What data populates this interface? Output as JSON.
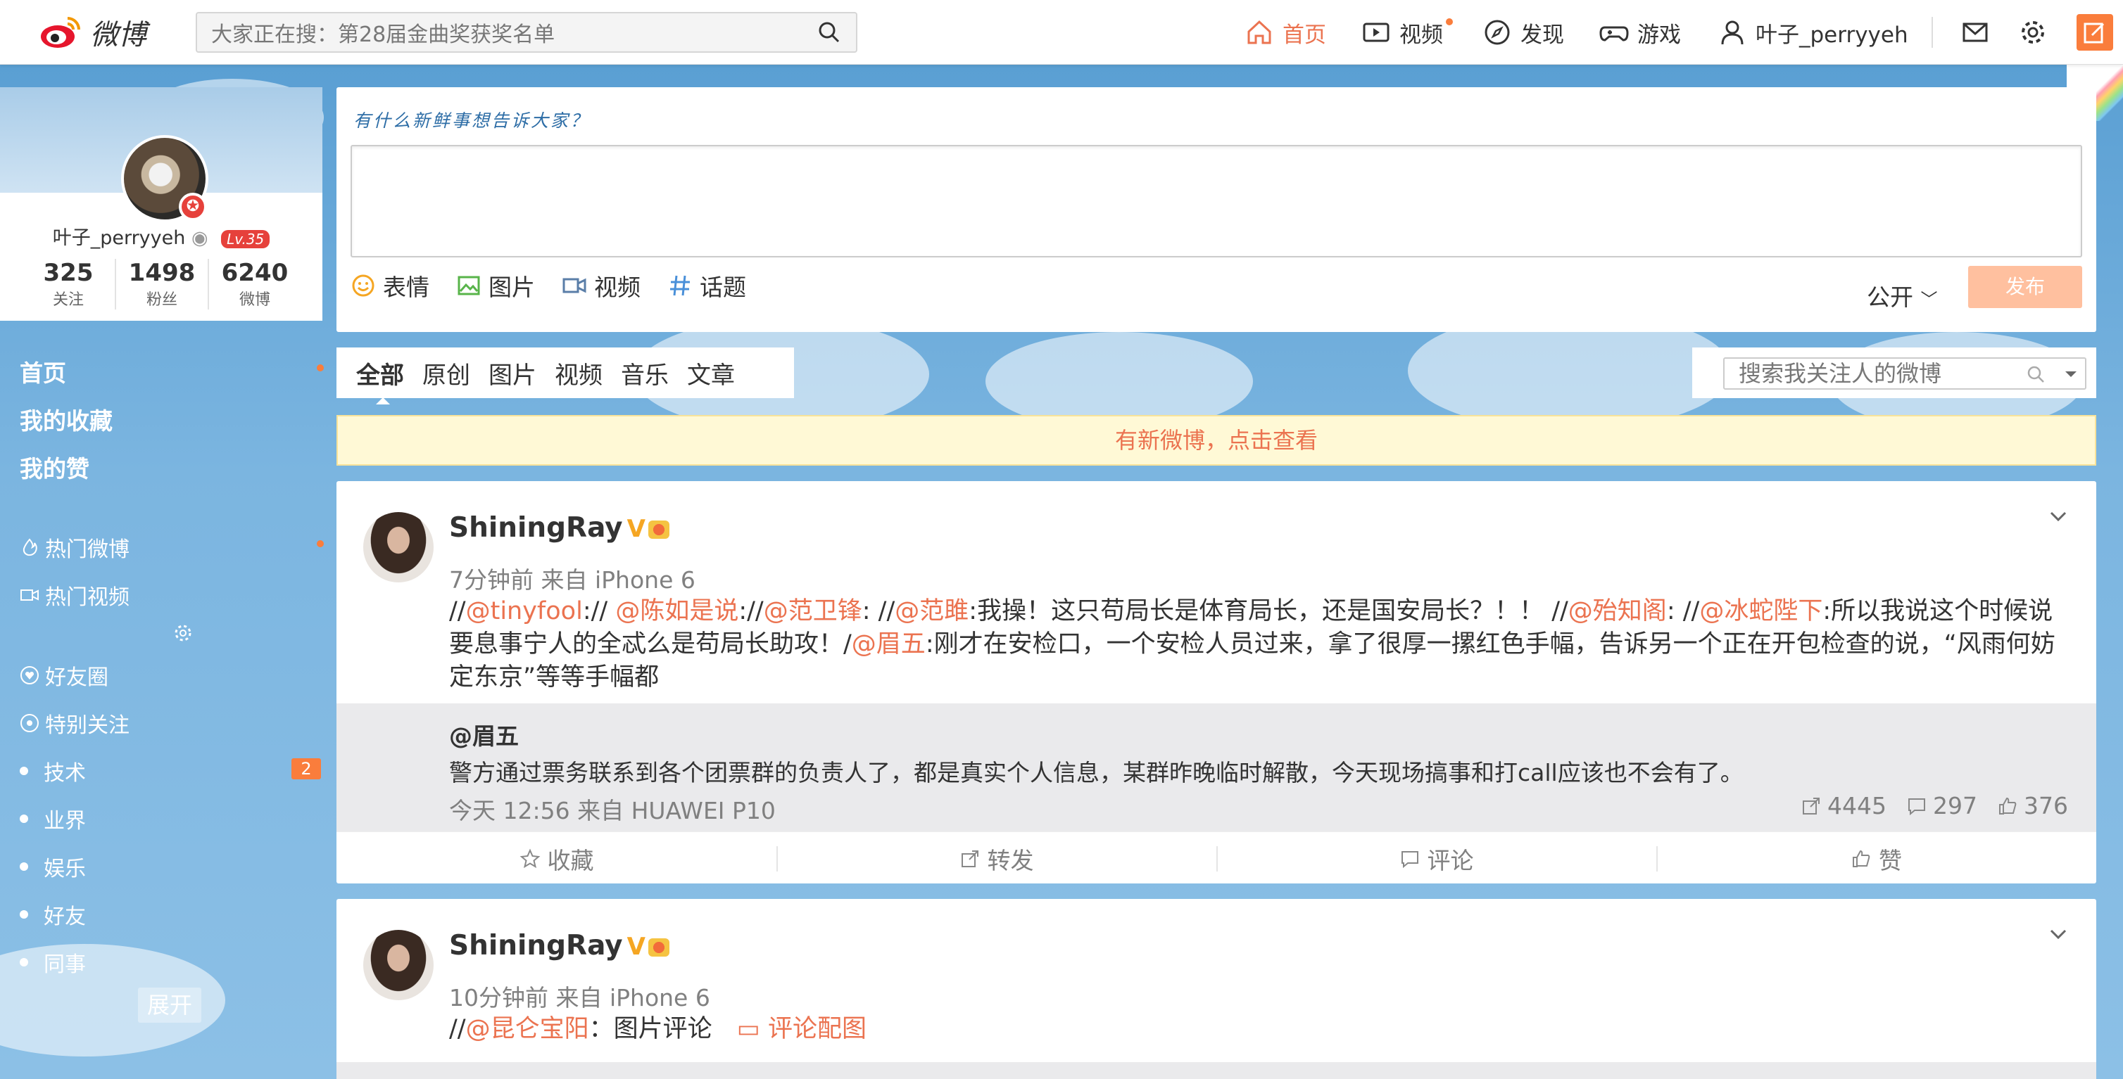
{
  "header": {
    "logo_text": "微博",
    "search_placeholder": "大家正在搜：第28届金曲奖获奖名单",
    "nav": [
      {
        "label": "首页",
        "icon": "home-icon",
        "active": true
      },
      {
        "label": "视频",
        "icon": "video-icon"
      },
      {
        "label": "发现",
        "icon": "compass-icon"
      },
      {
        "label": "游戏",
        "icon": "gamepad-icon"
      },
      {
        "label": "叶子_perryyeh",
        "icon": "user-icon"
      }
    ],
    "accent_color": "#eb7350"
  },
  "profile": {
    "name": "叶子_perryyeh",
    "level": "Lv.35",
    "stats": [
      {
        "value": "325",
        "label": "关注"
      },
      {
        "value": "1498",
        "label": "粉丝"
      },
      {
        "value": "6240",
        "label": "微博"
      }
    ]
  },
  "left_nav": {
    "primary": [
      "首页",
      "我的收藏",
      "我的赞"
    ],
    "hot": [
      "热门微博",
      "热门视频"
    ],
    "groups": [
      "好友圈",
      "特别关注"
    ],
    "lists": [
      "技术",
      "业界",
      "娱乐",
      "好友",
      "同事"
    ],
    "tech_badge": "2",
    "expand_label": "展开"
  },
  "publisher": {
    "hint": "有什么新鲜事想告诉大家？",
    "tools": [
      "表情",
      "图片",
      "视频",
      "话题"
    ],
    "visibility": "公开",
    "submit_label": "发布"
  },
  "feed_tabs": [
    "全部",
    "原创",
    "图片",
    "视频",
    "音乐",
    "文章"
  ],
  "feed_search_placeholder": "搜索我关注人的微博",
  "new_notice": "有新微博，点击查看",
  "posts": [
    {
      "author": "ShiningRay",
      "meta": "7分钟前 来自 iPhone 6",
      "segments": [
        {
          "t": "//"
        },
        {
          "t": "@tinyfool",
          "at": true
        },
        {
          "t": ":// "
        },
        {
          "t": "@陈如是说",
          "at": true
        },
        {
          "t": "://"
        },
        {
          "t": "@范卫锋",
          "at": true
        },
        {
          "t": ": //"
        },
        {
          "t": "@范雎",
          "at": true
        },
        {
          "t": ":我操！这只苟局长是体育局长，还是国安局长？！！ //"
        },
        {
          "t": "@殆知阁",
          "at": true
        },
        {
          "t": ": //"
        },
        {
          "t": "@冰蛇陛下",
          "at": true
        },
        {
          "t": ":所以我说这个时候说要息事宁人的全忒么是苟局长助攻！/"
        },
        {
          "t": "@眉五",
          "at": true
        },
        {
          "t": ":刚才在安检口，一个安检人员过来，拿了很厚一摞红色手幅，告诉另一个正在开包检查的说，“风雨何妨定东京”等等手幅都"
        }
      ],
      "retweet": {
        "author": "@眉五",
        "text": "警方通过票务联系到各个团票群的负责人了，都是真实个人信息，某群昨晚临时解散，今天现场搞事和打call应该也不会有了。",
        "meta": "今天 12:56 来自 HUAWEI P10",
        "reposts": "4445",
        "comments": "297",
        "likes": "376"
      },
      "actions": [
        "收藏",
        "转发",
        "评论",
        "赞"
      ]
    },
    {
      "author": "ShiningRay",
      "meta": "10分钟前 来自 iPhone 6",
      "segments": [
        {
          "t": "//"
        },
        {
          "t": "@昆仑宝阳",
          "at": true
        },
        {
          "t": "：图片评论"
        }
      ],
      "pic_comment_label": "评论配图"
    }
  ]
}
